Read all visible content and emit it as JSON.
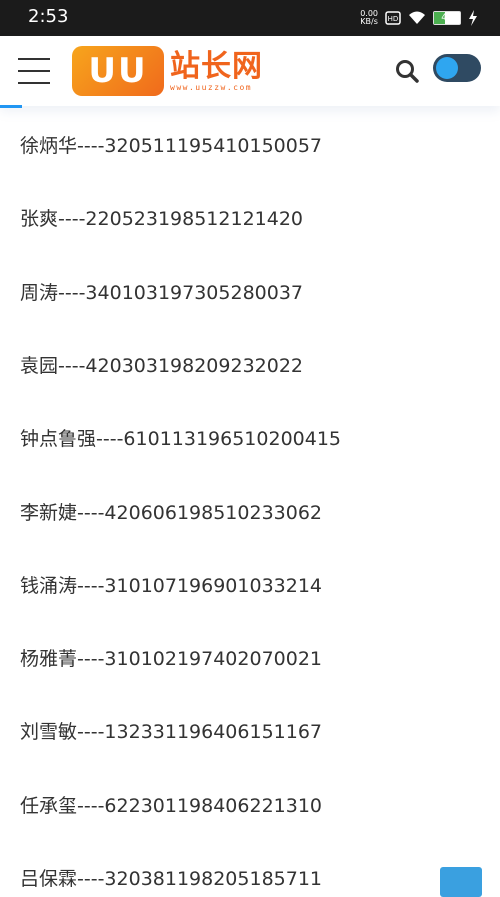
{
  "status_bar": {
    "time": "2:53",
    "net_speed_value": "0.00",
    "net_speed_unit": "KB/s",
    "battery_level": "44",
    "battery_fraction": 0.44
  },
  "header": {
    "logo_letters": "UU",
    "logo_cn": "站长网",
    "logo_url": "www.uuzzw.com",
    "accent_color": "#f0641c"
  },
  "entries": [
    "徐炳华----320511195410150057",
    "张爽----220523198512121420",
    "周涛----340103197305280037",
    "袁园----420303198209232022",
    "钟点鲁强----610113196510200415",
    "李新婕----420606198510233062",
    "钱涌涛----310107196901033214",
    "杨雅菁----310102197402070021",
    "刘雪敏----132331196406151167",
    "任承玺----622301198406221310",
    "吕保霖----320381198205185711"
  ]
}
